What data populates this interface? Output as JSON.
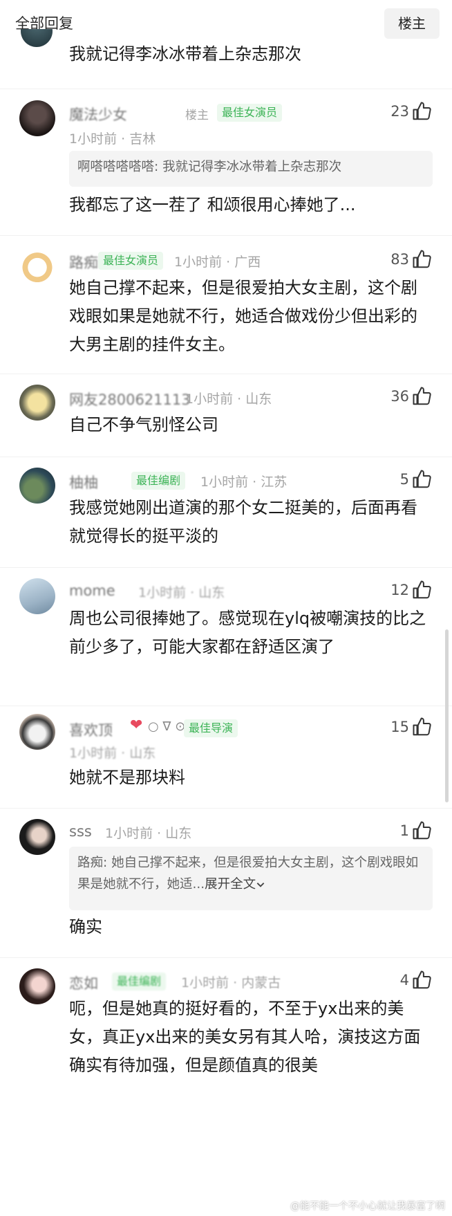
{
  "header": {
    "title": "全部回复",
    "owner_button": "楼主"
  },
  "first_line": "我就记得李冰冰带着上杂志那次",
  "comments": [
    {
      "username": "魔法少女",
      "owner_tag": "楼主",
      "badge": "最佳女演员",
      "meta": "1小时前 · 吉林",
      "likes": "23",
      "quote": "啊嗒嗒嗒嗒嗒: 我就记得李冰冰带着上杂志那次",
      "text": "我都忘了这一茬了 和颂很用心捧她了..."
    },
    {
      "username": "路痴",
      "badge": "最佳女演员",
      "meta": "1小时前 · 广西",
      "likes": "83",
      "text": "她自己撑不起来，但是很爱拍大女主剧，这个剧戏眼如果是她就不行，她适合做戏份少但出彩的大男主剧的挂件女主。"
    },
    {
      "username": "网友2800621113",
      "meta": "1小时前 · 山东",
      "likes": "36",
      "text": "自己不争气别怪公司"
    },
    {
      "username": "柚柚",
      "badge": "最佳编剧",
      "meta": "1小时前 · 江苏",
      "likes": "5",
      "text": "我感觉她刚出道演的那个女二挺美的，后面再看就觉得长的挺平淡的"
    },
    {
      "username": "mome",
      "meta": "1小时前 · 山东",
      "likes": "12",
      "text": "周也公司很捧她了。感觉现在ylq被嘲演技的比之前少多了，可能大家都在舒适区演了"
    },
    {
      "username": "喜欢顶",
      "badge": "最佳导演",
      "meta": "1小时前 · 山东",
      "likes": "15",
      "text": "她就不是那块料"
    },
    {
      "username": "sss",
      "meta": "1小时前 · 山东",
      "likes": "1",
      "quote": "路痴: 她自己撑不起来，但是很爱拍大女主剧，这个剧戏眼如果是她就不行，她适...",
      "quote_expand": "展开全文",
      "text": "确实"
    },
    {
      "username": "恋如",
      "badge": "最佳编剧",
      "meta": "1小时前 · 内蒙古",
      "likes": "4",
      "text": "呃，但是她真的挺好看的，不至于yx出来的美女，真正yx出来的美女另有其人哈，演技这方面确实有待加强，但是颜值真的很美"
    }
  ],
  "watermark": "@能不能一个不小心就让我暴富了啊",
  "colors": {
    "badge_green": "#3cb356",
    "badge_bg": "#ecf8ee",
    "meta_gray": "#a5a5a5",
    "quote_bg": "#f4f4f4"
  },
  "icons": {
    "likes": "thumbs-up-icon",
    "expand": "chevron-down-icon"
  }
}
